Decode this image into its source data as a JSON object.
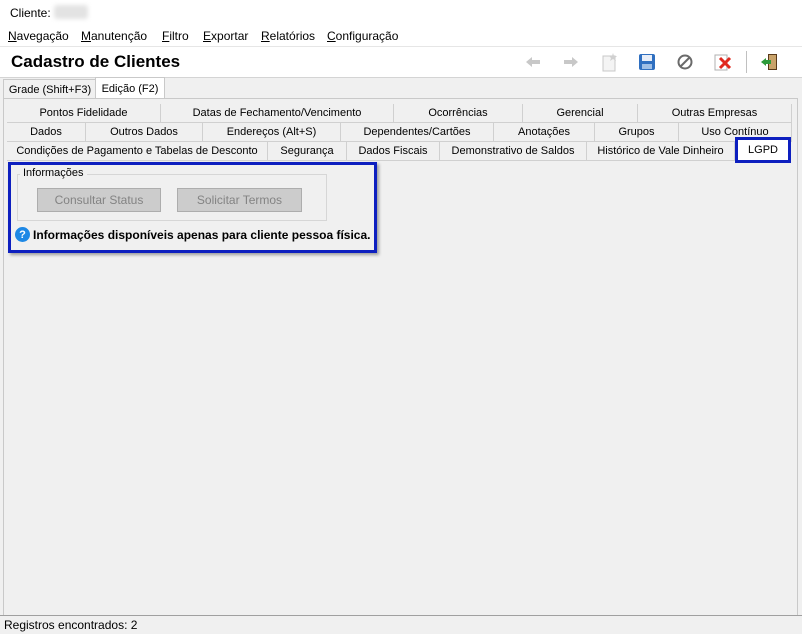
{
  "client_bar": {
    "label": "Cliente:"
  },
  "menu": [
    {
      "prefix": "",
      "accel": "N",
      "rest": "avegação"
    },
    {
      "prefix": "",
      "accel": "M",
      "rest": "anutenção"
    },
    {
      "prefix": "",
      "accel": "F",
      "rest": "iltro"
    },
    {
      "prefix": "",
      "accel": "E",
      "rest": "xportar"
    },
    {
      "prefix": "",
      "accel": "R",
      "rest": "elatórios"
    },
    {
      "prefix": "",
      "accel": "C",
      "rest": "onfiguração"
    }
  ],
  "header": {
    "title": "Cadastro de Clientes"
  },
  "toolbar": {
    "icons": [
      "arrow-left-icon",
      "arrow-right-icon",
      "new-record-icon",
      "save-icon",
      "cancel-icon",
      "delete-icon",
      "exit-icon"
    ]
  },
  "outer_tabs": [
    "Grade (Shift+F3)",
    "Edição (F2)"
  ],
  "inner_tabs": {
    "row1": [
      "Pontos Fidelidade",
      "Datas de Fechamento/Vencimento",
      "Ocorrências",
      "Gerencial",
      "Outras Empresas"
    ],
    "row2": [
      "Dados",
      "Outros Dados",
      "Endereços (Alt+S)",
      "Dependentes/Cartões",
      "Anotações",
      "Grupos",
      "Uso Contínuo"
    ],
    "row3": [
      "Condições de Pagamento e Tabelas de Desconto",
      "Segurança",
      "Dados Fiscais",
      "Demonstrativo de Saldos",
      "Histórico de Vale Dinheiro",
      "LGPD"
    ]
  },
  "lgpd": {
    "group_label": "Informações",
    "btn_status": "Consultar Status",
    "btn_terms": "Solicitar Termos",
    "info_icon": "?",
    "info_message": "Informações disponíveis apenas para cliente pessoa física."
  },
  "status": {
    "text": "Registros encontrados: 2"
  },
  "colors": {
    "highlight": "#0d1fbf",
    "info": "#1e88e5"
  }
}
